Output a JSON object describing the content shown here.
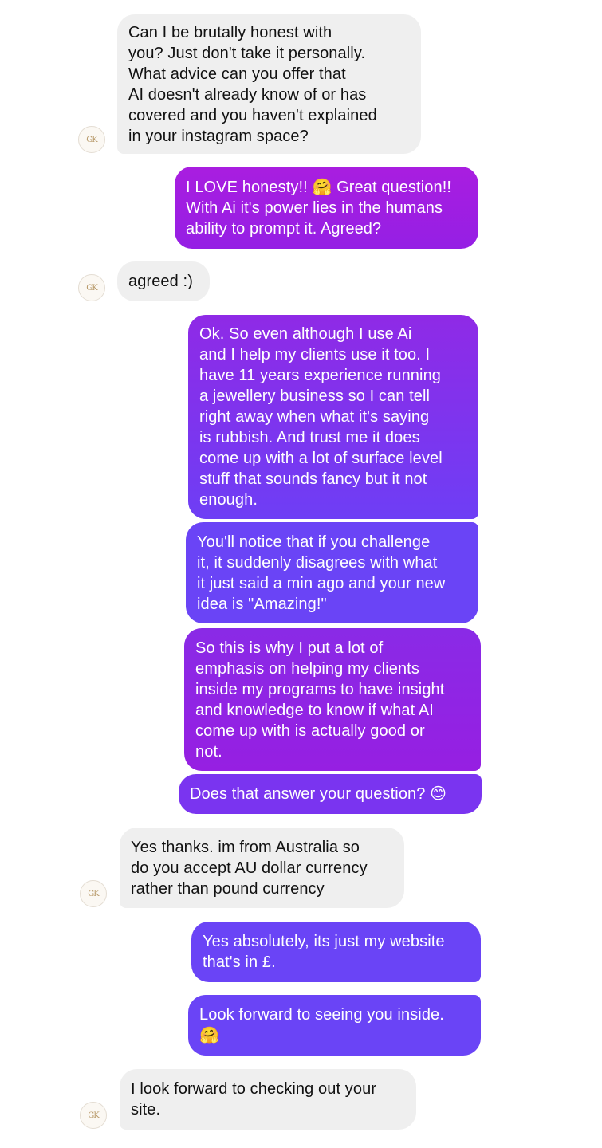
{
  "conversation": {
    "avatar_initials": "GK",
    "messages": [
      {
        "from": "other",
        "text": "Can I be brutally honest with\nyou? Just don't take it personally.\nWhat advice can you offer that\nAI doesn't already know of or has\ncovered and you haven't explained\nin your instagram space?"
      },
      {
        "from": "me",
        "text": "I LOVE honesty!! 🤗 Great question!!\nWith Ai it's power lies in the humans\nability to prompt it. Agreed?"
      },
      {
        "from": "other",
        "text": "agreed :)"
      },
      {
        "from": "me",
        "text": "Ok. So even although I use Ai\nand I help my clients use it too. I\nhave 11 years experience running\na jewellery business so I can tell\nright away when what it's saying\nis rubbish. And trust me it does\ncome up with a lot of surface level\nstuff that sounds fancy but it not\nenough."
      },
      {
        "from": "me",
        "text": "You'll notice that if you challenge\nit, it suddenly disagrees with what\nit just said a min ago and your new\nidea is \"Amazing!\""
      },
      {
        "from": "me",
        "text": "So this is why I put a lot of\nemphasis on helping my clients\ninside my programs to have insight\nand knowledge to know if what AI\ncome up with is actually good or\nnot."
      },
      {
        "from": "me",
        "text": "Does that answer your question? 😊"
      },
      {
        "from": "other",
        "text": "Yes thanks. im from Australia so\ndo you accept AU dollar currency\nrather than pound currency"
      },
      {
        "from": "me",
        "text": "Yes absolutely, its just my website\nthat's in £."
      },
      {
        "from": "me",
        "text": "Look forward to seeing you inside.\n🤗"
      },
      {
        "from": "other",
        "text": "I look forward to checking out your\nsite."
      }
    ]
  },
  "colors": {
    "incoming_bubble": "#efefef",
    "outgoing_purple": "#9a1fe0",
    "outgoing_violet": "#6c40f8"
  }
}
